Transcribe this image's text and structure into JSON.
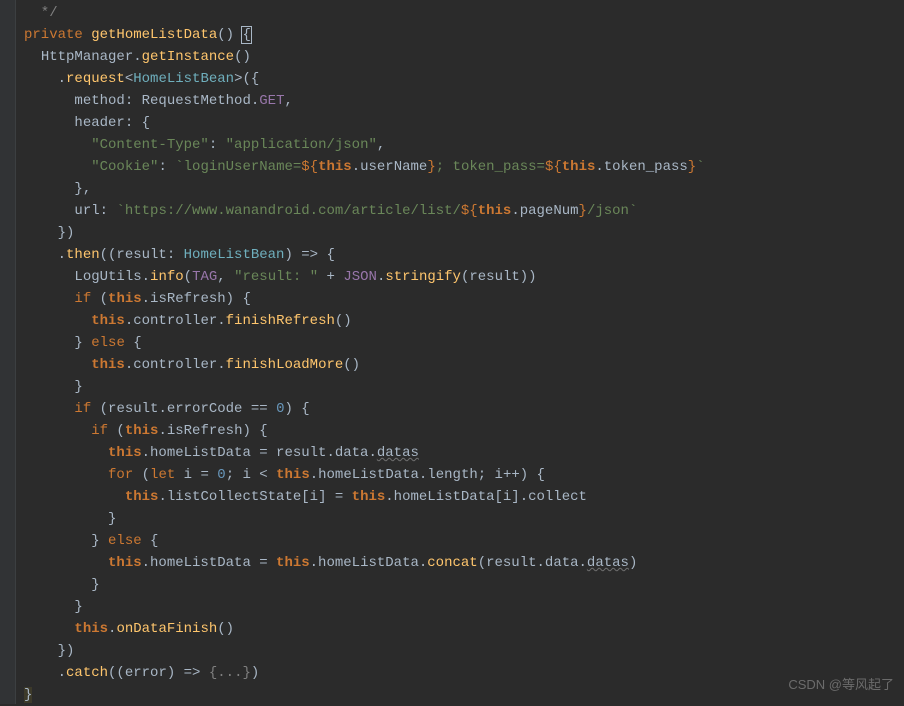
{
  "watermark": "CSDN @等风起了",
  "code": {
    "l1": {
      "kw": "private",
      "fn": "getHomeListData",
      "paren": "() ",
      "brace": "{"
    },
    "l2": {
      "a": "HttpManager.",
      "b": "getInstance",
      "c": "()"
    },
    "l3": {
      "a": ".",
      "b": "request",
      "c": "<",
      "d": "HomeListBean",
      "e": ">({"
    },
    "l4": {
      "a": "method: RequestMethod.",
      "b": "GET",
      ",": ","
    },
    "l5": {
      "a": "header: {"
    },
    "l6": {
      "a": "\"Content-Type\"",
      "b": ": ",
      "c": "\"application/json\"",
      ",": ","
    },
    "l7": {
      "a": "\"Cookie\"",
      "b": ": ",
      "c": "`loginUserName=",
      "d": "${",
      "e": "this",
      "f": ".userName",
      "g": "}",
      "h": "; token_pass=",
      "i": "${",
      "j": "this",
      "k": ".token_pass",
      "l": "}",
      "m": "`"
    },
    "l8": {
      "a": "},"
    },
    "l9": {
      "a": "url: ",
      "b": "`https://www.wanandroid.com/article/list/",
      "c": "${",
      "d": "this",
      "e": ".pageNum",
      "f": "}",
      "g": "/json`"
    },
    "l10": {
      "a": "})"
    },
    "l11": {
      "a": ".",
      "b": "then",
      "c": "((result: ",
      "d": "HomeListBean",
      "e": ") => {"
    },
    "l12": {
      "a": "LogUtils.",
      "b": "info",
      "c": "(",
      "d": "TAG",
      ",": ", ",
      "e": "\"result: \"",
      "f": " + ",
      "g": "JSON",
      "h": ".",
      "i": "stringify",
      "j": "(result))"
    },
    "l13": {
      "a": "if",
      "b": " (",
      "c": "this",
      "d": ".isRefresh) {"
    },
    "l14": {
      "a": "this",
      "b": ".controller.",
      "c": "finishRefresh",
      "d": "()"
    },
    "l15": {
      "a": "} ",
      "b": "else",
      "c": " {"
    },
    "l16": {
      "a": "this",
      "b": ".controller.",
      "c": "finishLoadMore",
      "d": "()"
    },
    "l17": {
      "a": "}"
    },
    "l18": {
      "a": "if",
      "b": " (result.errorCode == ",
      "c": "0",
      "d": ") {"
    },
    "l19": {
      "a": "if",
      "b": " (",
      "c": "this",
      "d": ".isRefresh) {"
    },
    "l20": {
      "a": "this",
      "b": ".homeListData = result.data.",
      "c": "datas"
    },
    "l21": {
      "a": "for",
      "b": " (",
      "c": "let",
      "d": " i = ",
      "e": "0",
      "f": "; i < ",
      "g": "this",
      "h": ".homeListData.length; i++) {"
    },
    "l22": {
      "a": "this",
      "b": ".listCollectState[i] = ",
      "c": "this",
      "d": ".homeListData[i].collect"
    },
    "l23": {
      "a": "}"
    },
    "l24": {
      "a": "} ",
      "b": "else",
      "c": " {"
    },
    "l25": {
      "a": "this",
      "b": ".homeListData = ",
      "c": "this",
      "d": ".homeListData.",
      "e": "concat",
      "f": "(result.data.",
      "g": "datas",
      "h": ")"
    },
    "l26": {
      "a": "}"
    },
    "l27": {
      "a": "}"
    },
    "l28": {
      "a": "this",
      "b": ".",
      "c": "onDataFinish",
      "d": "()"
    },
    "l29": {
      "a": "})"
    },
    "l30": {
      "a": ".",
      "b": "catch",
      "c": "((error) => ",
      "d": "{...}",
      "e": ")"
    },
    "l31": {
      "a": "}"
    }
  }
}
